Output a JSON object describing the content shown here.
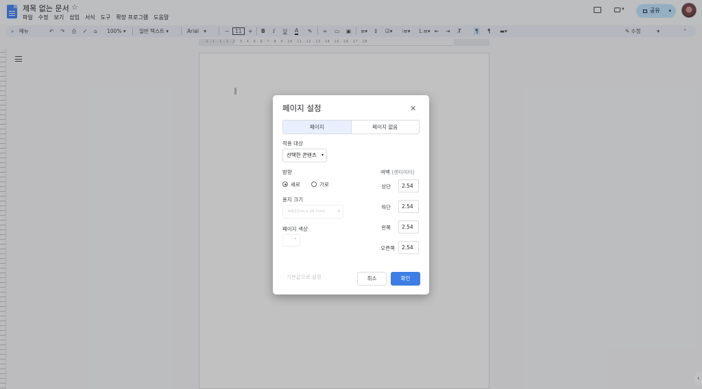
{
  "header": {
    "doc_title": "제목 없는 문서",
    "menu": [
      "파일",
      "수정",
      "보기",
      "삽입",
      "서식",
      "도구",
      "확장 프로그램",
      "도움말"
    ],
    "share_label": "공유"
  },
  "toolbar": {
    "menu_search": "메뉴",
    "zoom": "100%",
    "style": "일반 텍스트",
    "font": "Arial",
    "font_size": "11",
    "mode": "수정"
  },
  "ruler": {
    "numbers": "2 · 1 · 1 · 1 · 2 · 3 · 4 · 5 · 6 · 7 · 8 · 9 · 10 · 11 · 12 · 13 · 14 · 15 · 16 · 17 · 18"
  },
  "dialog": {
    "title": "페이지 설정",
    "tabs": [
      "페이지",
      "페이지 없음"
    ],
    "apply_to_label": "적용 대상",
    "apply_to_value": "선택한 콘텐츠",
    "orientation_label": "방향",
    "orientation_options": [
      "세로",
      "가로"
    ],
    "paper_size_label": "용지 크기",
    "paper_size_value": "A4(21cm x 29.7cm)",
    "page_color_label": "페이지 색상",
    "margins_label": "여백",
    "margins_unit": "(센티미터)",
    "margins": [
      {
        "label": "상단",
        "value": "2.54"
      },
      {
        "label": "하단",
        "value": "2.54"
      },
      {
        "label": "왼쪽",
        "value": "2.54"
      },
      {
        "label": "오른쪽",
        "value": "2.54"
      }
    ],
    "default_button": "기본값으로 설정",
    "cancel_button": "취소",
    "ok_button": "확인"
  },
  "colors": {
    "accent": "#3d7de4",
    "share_bg": "#c2e7ff",
    "doc_blue": "#4285f4"
  }
}
